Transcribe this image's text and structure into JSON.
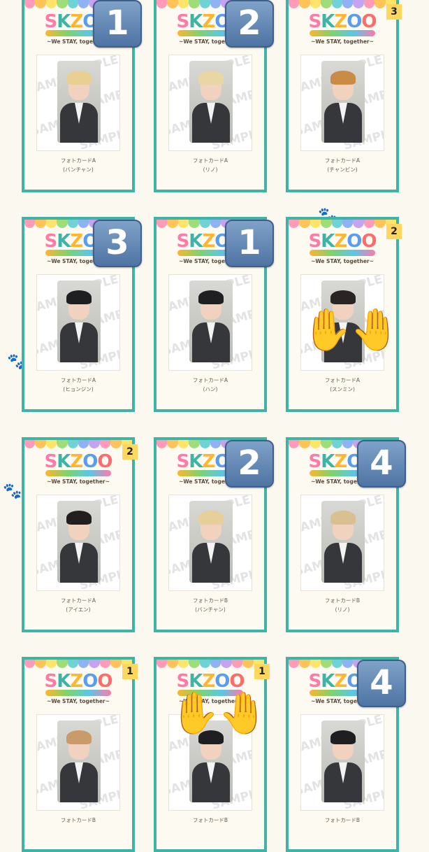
{
  "logo": {
    "part1": "S",
    "part2": "K",
    "part3": "Z",
    "part4": "O",
    "part5": "O",
    "tagline": "~We STAY, together~"
  },
  "watermark_text": "SAMPLE",
  "cards": [
    {
      "label_line1": "フォトカードA",
      "label_line2": "(バンチャン)",
      "badge": "1",
      "badge_style": "big",
      "hair": "#e9cf93",
      "hands": false
    },
    {
      "label_line1": "フォトカードA",
      "label_line2": "(リノ)",
      "badge": "2",
      "badge_style": "big",
      "hair": "#e9d6a5",
      "hands": false
    },
    {
      "label_line1": "フォトカードA",
      "label_line2": "(チャンビン)",
      "badge": "3",
      "badge_style": "small",
      "hair": "#c98b45",
      "hands": false
    },
    {
      "label_line1": "フォトカードA",
      "label_line2": "(ヒョンジン)",
      "badge": "3",
      "badge_style": "big",
      "hair": "#1f1f22",
      "hands": false
    },
    {
      "label_line1": "フォトカードA",
      "label_line2": "(ハン)",
      "badge": "1",
      "badge_style": "big",
      "hair": "#1f1f22",
      "hands": false
    },
    {
      "label_line1": "フォトカードA",
      "label_line2": "(スンミン)",
      "badge": "2",
      "badge_style": "small",
      "hair": "#2a2524",
      "hands": true
    },
    {
      "label_line1": "フォトカードA",
      "label_line2": "(アイエン)",
      "badge": "2",
      "badge_style": "small",
      "hair": "#231f1f",
      "hands": false
    },
    {
      "label_line1": "フォトカードB",
      "label_line2": "(バンチャン)",
      "badge": "2",
      "badge_style": "big",
      "hair": "#e6cf98",
      "hands": false
    },
    {
      "label_line1": "フォトカードB",
      "label_line2": "(リノ)",
      "badge": "4",
      "badge_style": "big",
      "hair": "#d9c091",
      "hands": false
    },
    {
      "label_line1": "フォトカードB",
      "label_line2": "",
      "badge": "1",
      "badge_style": "small",
      "hair": "#c99a6a",
      "hands": false
    },
    {
      "label_line1": "フォトカードB",
      "label_line2": "",
      "badge": "1",
      "badge_style": "small",
      "hair": "#1f1f22",
      "hands": true
    },
    {
      "label_line1": "フォトカードB",
      "label_line2": "",
      "badge": "4",
      "badge_style": "big",
      "hair": "#1f1f22",
      "hands": false
    }
  ],
  "emoji": {
    "raised_hands": "🤚",
    "paw": "🐾"
  },
  "colors": {
    "frame": "#3eb3a6",
    "badge_gray": "#5b7ba7",
    "badge_yellow": "#ffd75e"
  }
}
